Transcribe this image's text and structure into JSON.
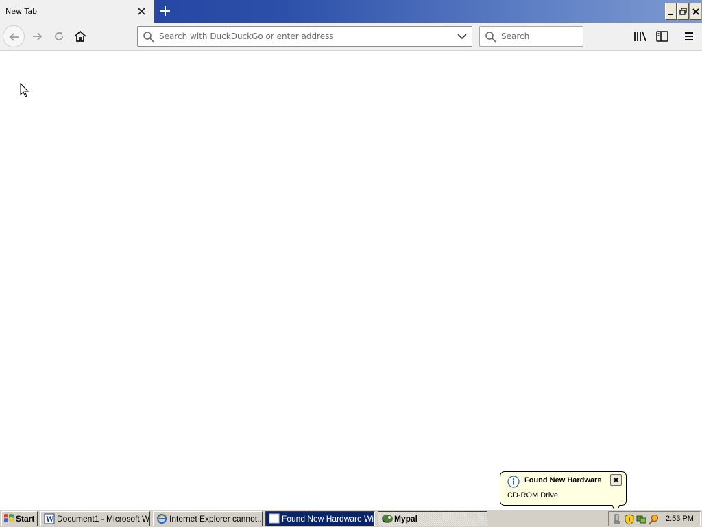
{
  "browser": {
    "tab": {
      "title": "New Tab"
    },
    "urlbar": {
      "placeholder": "Search with DuckDuckGo or enter address",
      "value": ""
    },
    "searchbar": {
      "placeholder": "Search",
      "value": ""
    }
  },
  "notification": {
    "title": "Found New Hardware",
    "message": "CD-ROM Drive"
  },
  "taskbar": {
    "start_label": "Start",
    "tasks": [
      {
        "label": "Document1 - Microsoft W...",
        "icon": "word-icon"
      },
      {
        "label": "Internet Explorer cannot...",
        "icon": "ie-icon"
      },
      {
        "label": "Found New Hardware Wi...",
        "icon": "window-icon"
      },
      {
        "label": "Mypal",
        "icon": "mypal-icon"
      }
    ],
    "clock": "2:53 PM"
  },
  "colors": {
    "titlebar_start": "#1f3f9e",
    "taskbar_active": "#0a246a",
    "balloon_bg": "#ffffe1"
  }
}
